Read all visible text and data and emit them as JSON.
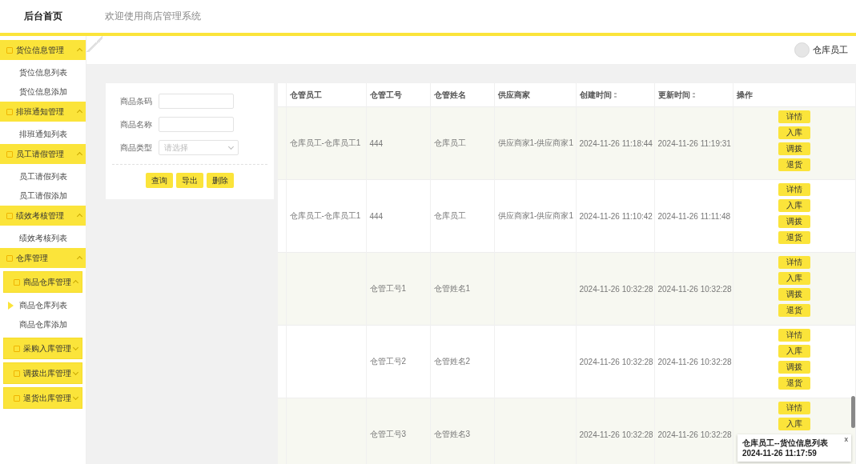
{
  "header": {
    "logo": "后台首页",
    "welcome": "欢迎使用商店管理系统",
    "user": "仓库员工"
  },
  "sidebar": [
    {
      "label": "货位信息管理",
      "expanded": true,
      "children": [
        {
          "label": "货位信息列表",
          "selected": false
        },
        {
          "label": "货位信息添加",
          "selected": false
        }
      ]
    },
    {
      "label": "排班通知管理",
      "expanded": true,
      "children": [
        {
          "label": "排班通知列表",
          "selected": false
        }
      ]
    },
    {
      "label": "员工请假管理",
      "expanded": true,
      "children": [
        {
          "label": "员工请假列表",
          "selected": false
        },
        {
          "label": "员工请假添加",
          "selected": false
        }
      ]
    },
    {
      "label": "绩效考核管理",
      "expanded": true,
      "children": [
        {
          "label": "绩效考核列表",
          "selected": false
        }
      ]
    },
    {
      "label": "仓库管理",
      "expanded": true,
      "children": [
        {
          "label": "商品仓库管理",
          "expanded": true,
          "children": [
            {
              "label": "商品仓库列表",
              "selected": true
            },
            {
              "label": "商品仓库添加",
              "selected": false
            }
          ]
        },
        {
          "label": "采购入库管理",
          "expanded": false
        },
        {
          "label": "调拨出库管理",
          "expanded": false
        },
        {
          "label": "退货出库管理",
          "expanded": false
        }
      ]
    }
  ],
  "search": {
    "fields": [
      {
        "label": "商品条码",
        "kind": "text"
      },
      {
        "label": "商品名称",
        "kind": "text"
      },
      {
        "label": "商品类型",
        "kind": "select",
        "placeholder": "请选择"
      }
    ],
    "buttons": [
      "查询",
      "导出",
      "删除"
    ]
  },
  "table": {
    "columns": [
      {
        "label": "仓管员工",
        "sortable": false
      },
      {
        "label": "仓管工号",
        "sortable": false
      },
      {
        "label": "仓管姓名",
        "sortable": false
      },
      {
        "label": "供应商家",
        "sortable": false
      },
      {
        "label": "创建时间",
        "sortable": true
      },
      {
        "label": "更新时间",
        "sortable": true
      },
      {
        "label": "操作",
        "sortable": false
      }
    ],
    "rows": [
      {
        "cells": [
          "仓库员工-仓库员工1",
          "444",
          "仓库员工",
          "供应商家1-供应商家1",
          "2024-11-26 11:18:44",
          "2024-11-26 11:19:31"
        ],
        "actions": [
          "详情",
          "入库",
          "调拨",
          "退货"
        ]
      },
      {
        "cells": [
          "仓库员工-仓库员工1",
          "444",
          "仓库员工",
          "供应商家1-供应商家1",
          "2024-11-26 11:10:42",
          "2024-11-26 11:11:48"
        ],
        "actions": [
          "详情",
          "入库",
          "调拨",
          "退货"
        ]
      },
      {
        "cells": [
          "",
          "仓管工号1",
          "仓管姓名1",
          "",
          "2024-11-26 10:32:28",
          "2024-11-26 10:32:28"
        ],
        "actions": [
          "详情",
          "入库",
          "调拨",
          "退货"
        ]
      },
      {
        "cells": [
          "",
          "仓管工号2",
          "仓管姓名2",
          "",
          "2024-11-26 10:32:28",
          "2024-11-26 10:32:28"
        ],
        "actions": [
          "详情",
          "入库",
          "调拨",
          "退货"
        ]
      },
      {
        "cells": [
          "",
          "仓管工号3",
          "仓管姓名3",
          "",
          "2024-11-26 10:32:28",
          "2024-11-26 10:32:28"
        ],
        "actions": [
          "详情",
          "入库"
        ]
      }
    ]
  },
  "toast": {
    "close": "x",
    "message": "仓库员工--货位信息列表 2024-11-26 11:17:59"
  }
}
